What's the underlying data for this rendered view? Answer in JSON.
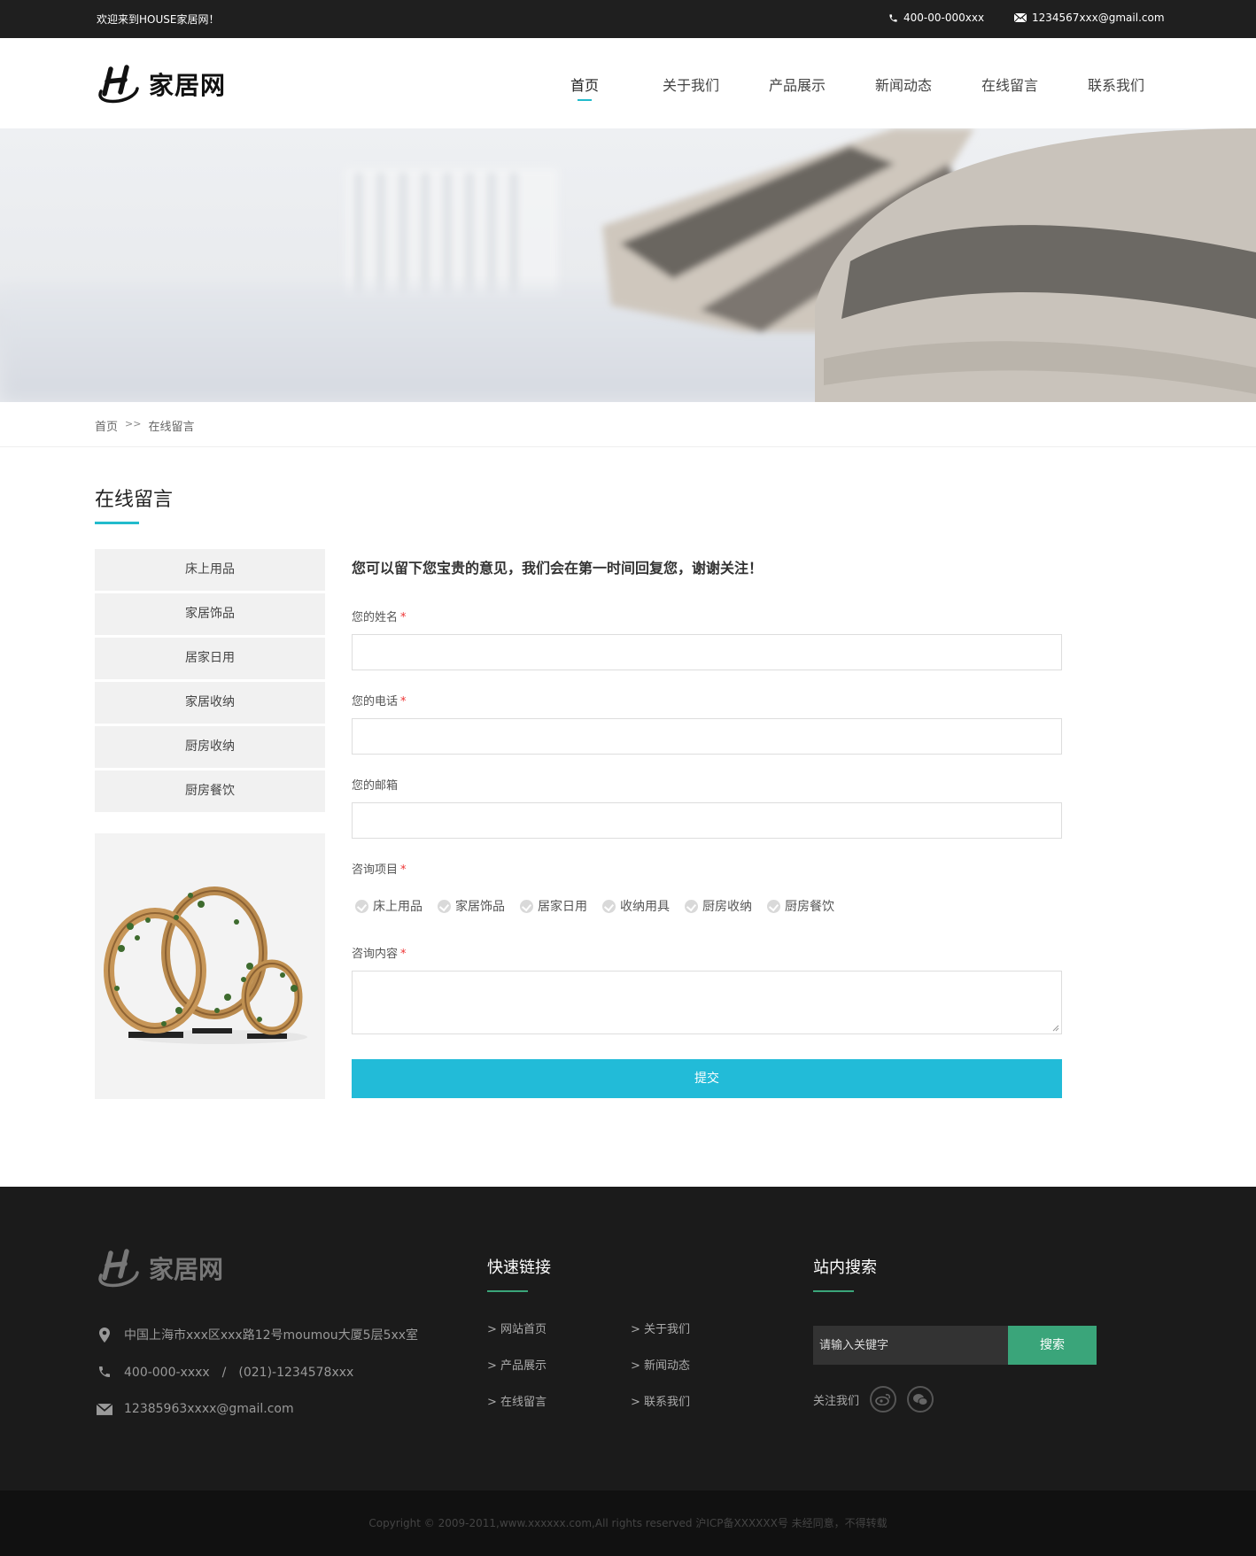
{
  "topbar": {
    "welcome": "欢迎来到HOUSE家居网！",
    "phone": "400-00-000xxx",
    "email": "1234567xxx@gmail.com"
  },
  "header": {
    "logo_text": "家居网",
    "nav": [
      {
        "label": "首页",
        "active": true
      },
      {
        "label": "关于我们"
      },
      {
        "label": "产品展示"
      },
      {
        "label": "新闻动态"
      },
      {
        "label": "在线留言"
      },
      {
        "label": "联系我们"
      }
    ]
  },
  "breadcrumb": {
    "home": "首页",
    "separator": ">>",
    "current": "在线留言"
  },
  "section": {
    "title": "在线留言"
  },
  "sidebar": {
    "items": [
      "床上用品",
      "家居饰品",
      "居家日用",
      "家居收纳",
      "厨房收纳",
      "厨房餐饮"
    ]
  },
  "form": {
    "intro": "您可以留下您宝贵的意见，我们会在第一时间回复您，谢谢关注！",
    "name_label": "您的姓名",
    "phone_label": "您的电话",
    "email_label": "您的邮箱",
    "project_label": "咨询项目",
    "content_label": "咨询内容",
    "required_mark": "*",
    "options": [
      "床上用品",
      "家居饰品",
      "居家日用",
      "收纳用具",
      "厨房收纳",
      "厨房餐饮"
    ],
    "submit_label": "提交"
  },
  "footer": {
    "logo_text": "家居网",
    "address": "中国上海市xxx区xxx路12号moumou大厦5层5xx室",
    "phone": "400-000-xxxx　/　(021)-1234578xxx",
    "email": "12385963xxxx@gmail.com",
    "links_title": "快速链接",
    "links": [
      "> 网站首页",
      "> 关于我们",
      "> 产品展示",
      "> 新闻动态",
      "> 在线留言",
      "> 联系我们"
    ],
    "search_title": "站内搜索",
    "search_placeholder": "请输入关键字",
    "search_button": "搜索",
    "follow_label": "关注我们",
    "copyright": "Copyright © 2009-2011,www.xxxxxx.com,All rights reserved  沪ICP备XXXXXX号 未经同意，不得转载"
  },
  "colors": {
    "accent": "#22bbcc",
    "submit": "#22bbd8",
    "footer_green": "#3aa57a",
    "topbar_bg": "#1f1f1f",
    "footer_bg": "#1b1b1b"
  }
}
